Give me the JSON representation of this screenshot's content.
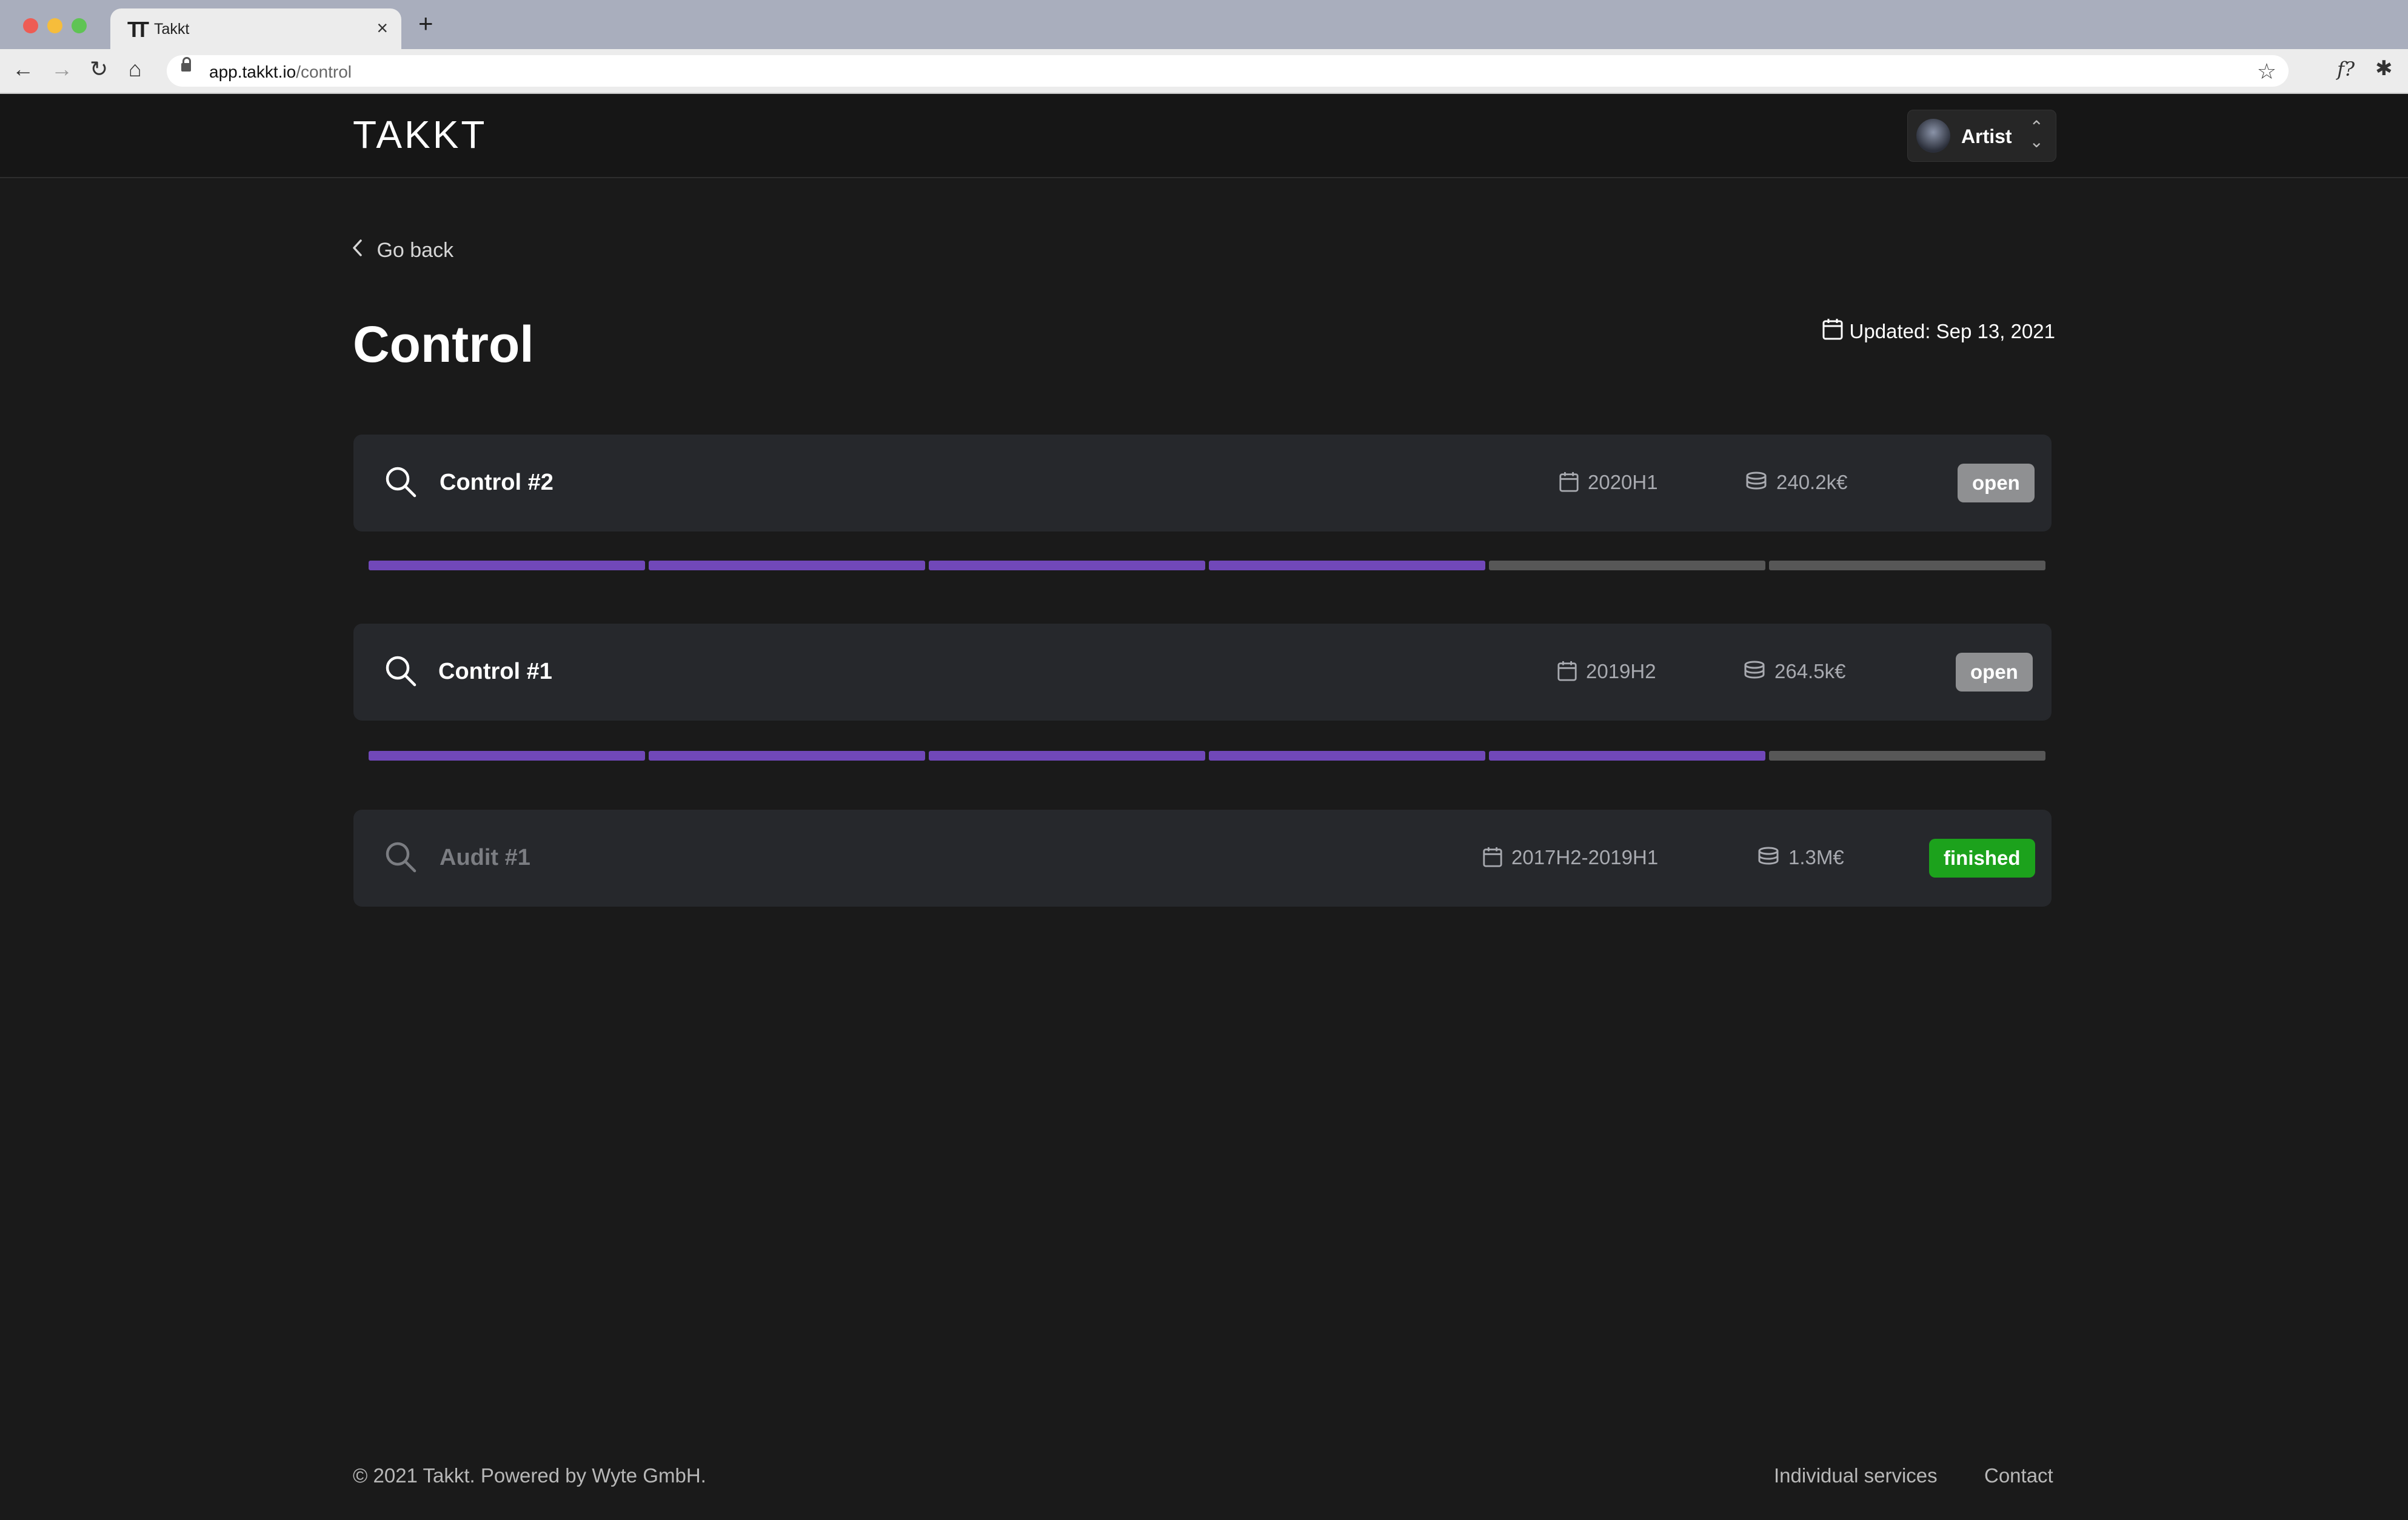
{
  "browser": {
    "tab_title": "Takkt",
    "tab_close": "×",
    "new_tab": "+",
    "url_host": "app.takkt.io",
    "url_path": "/control",
    "ext_label": "f?"
  },
  "header": {
    "logo": "TAKKT",
    "account_name": "Artist"
  },
  "page": {
    "go_back": "Go back",
    "title": "Control",
    "updated": "Updated: Sep 13, 2021"
  },
  "cards": [
    {
      "title": "Control #2",
      "period": "2020H1",
      "amount": "240.2k€",
      "status": "open",
      "progress_done": 4,
      "progress_total": 6
    },
    {
      "title": "Control #1",
      "period": "2019H2",
      "amount": "264.5k€",
      "status": "open",
      "progress_done": 5,
      "progress_total": 6
    },
    {
      "title": "Audit #1",
      "period": "2017H2-2019H1",
      "amount": "1.3M€",
      "status": "finished"
    }
  ],
  "footer": {
    "copyright": "© 2021 Takkt. Powered by Wyte GmbH.",
    "individual_services": "Individual services",
    "contact": "Contact"
  },
  "colors": {
    "progress_done": "#7148b9",
    "progress_pending": "#575757",
    "badge_open": "#8f9092",
    "badge_finished": "#1ca21c",
    "background": "#1a1a1a",
    "card": "#26282c"
  }
}
